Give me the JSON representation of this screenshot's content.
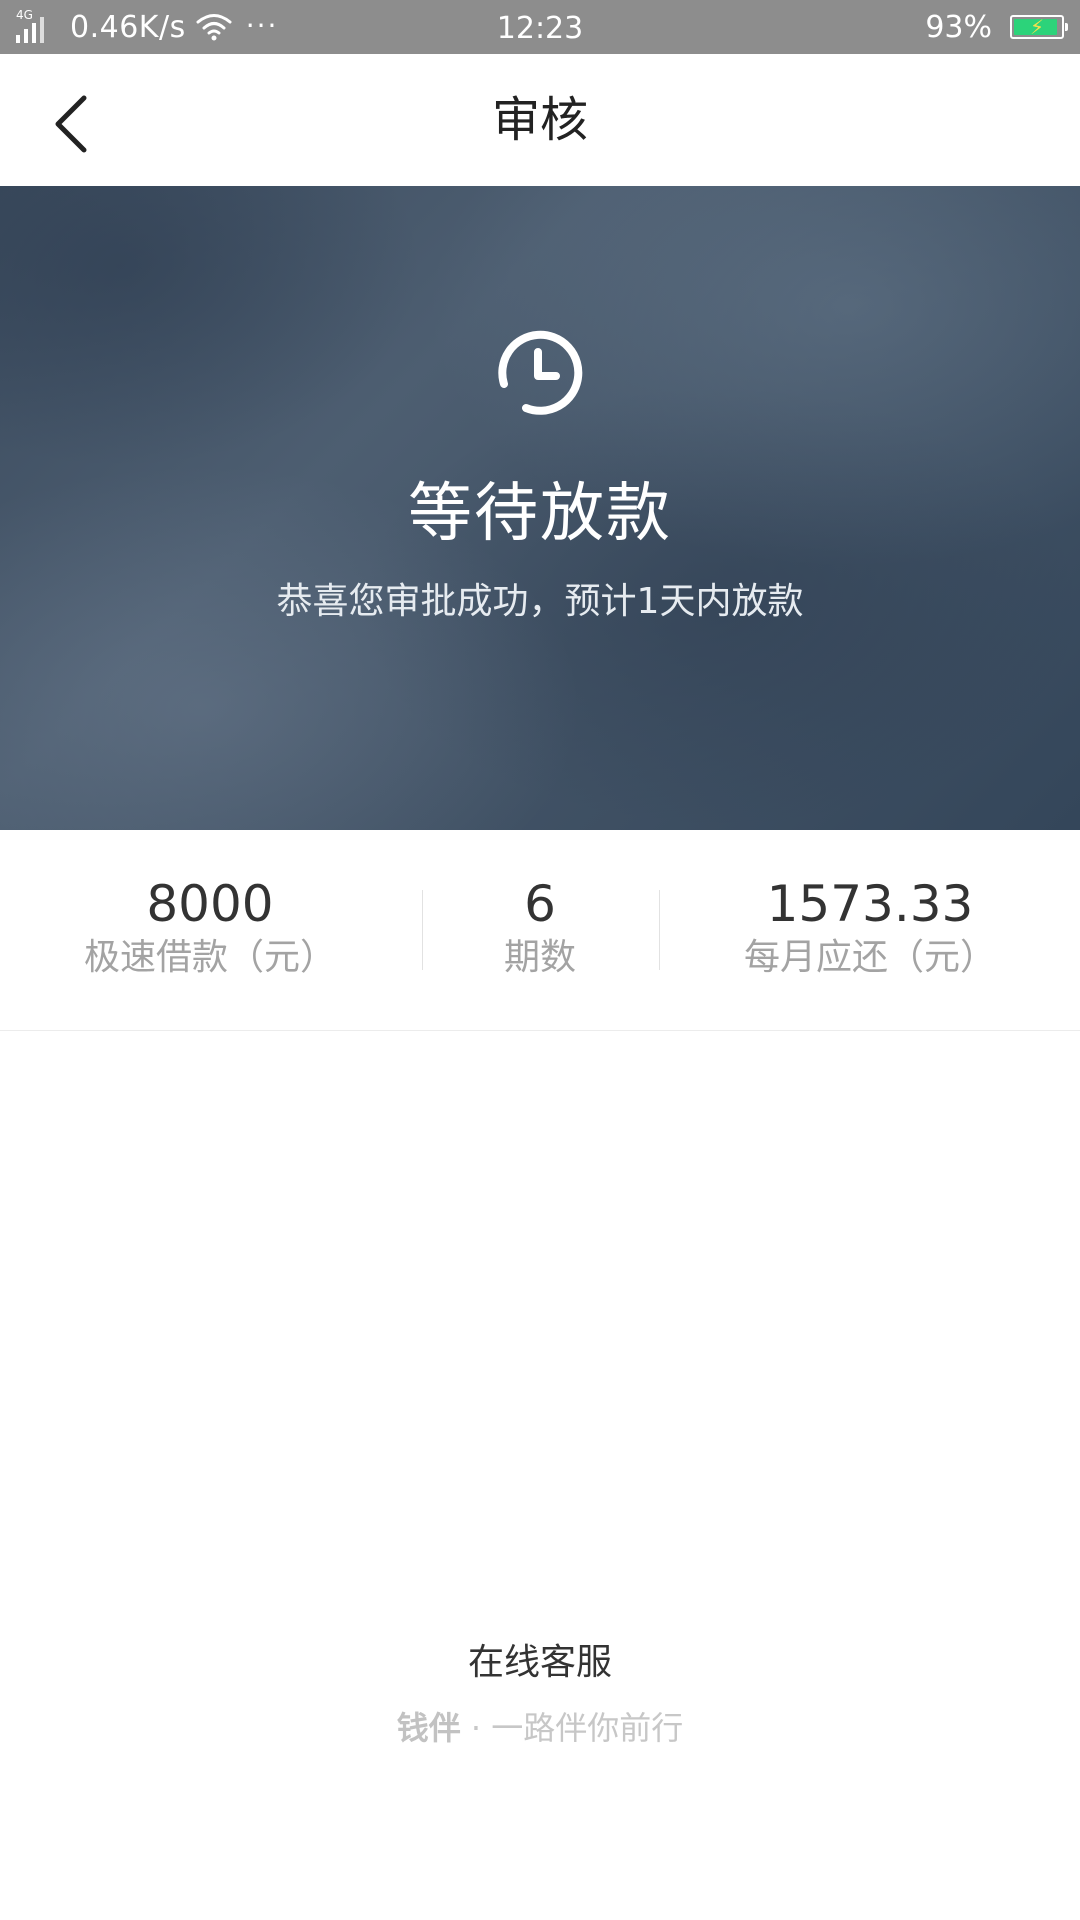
{
  "status_bar": {
    "network_tag": "4G",
    "speed": "0.46K/s",
    "more": "···",
    "time": "12:23",
    "battery_percent": "93%",
    "battery_level": 0.93,
    "battery_color": "#2cd37a"
  },
  "nav": {
    "title": "审核",
    "back_icon": "chevron-left-icon"
  },
  "hero": {
    "icon": "clock-icon",
    "title": "等待放款",
    "subtitle": "恭喜您审批成功，预计1天内放款"
  },
  "stats": [
    {
      "value": "8000",
      "label": "极速借款（元）"
    },
    {
      "value": "6",
      "label": "期数"
    },
    {
      "value": "1573.33",
      "label": "每月应还（元）"
    }
  ],
  "footer": {
    "service_label": "在线客服",
    "brand": "钱伴",
    "separator": "·",
    "slogan": "一路伴你前行"
  },
  "colors": {
    "hero_base": "#435467",
    "text_primary": "#333333",
    "text_muted": "#a3a3a3"
  }
}
